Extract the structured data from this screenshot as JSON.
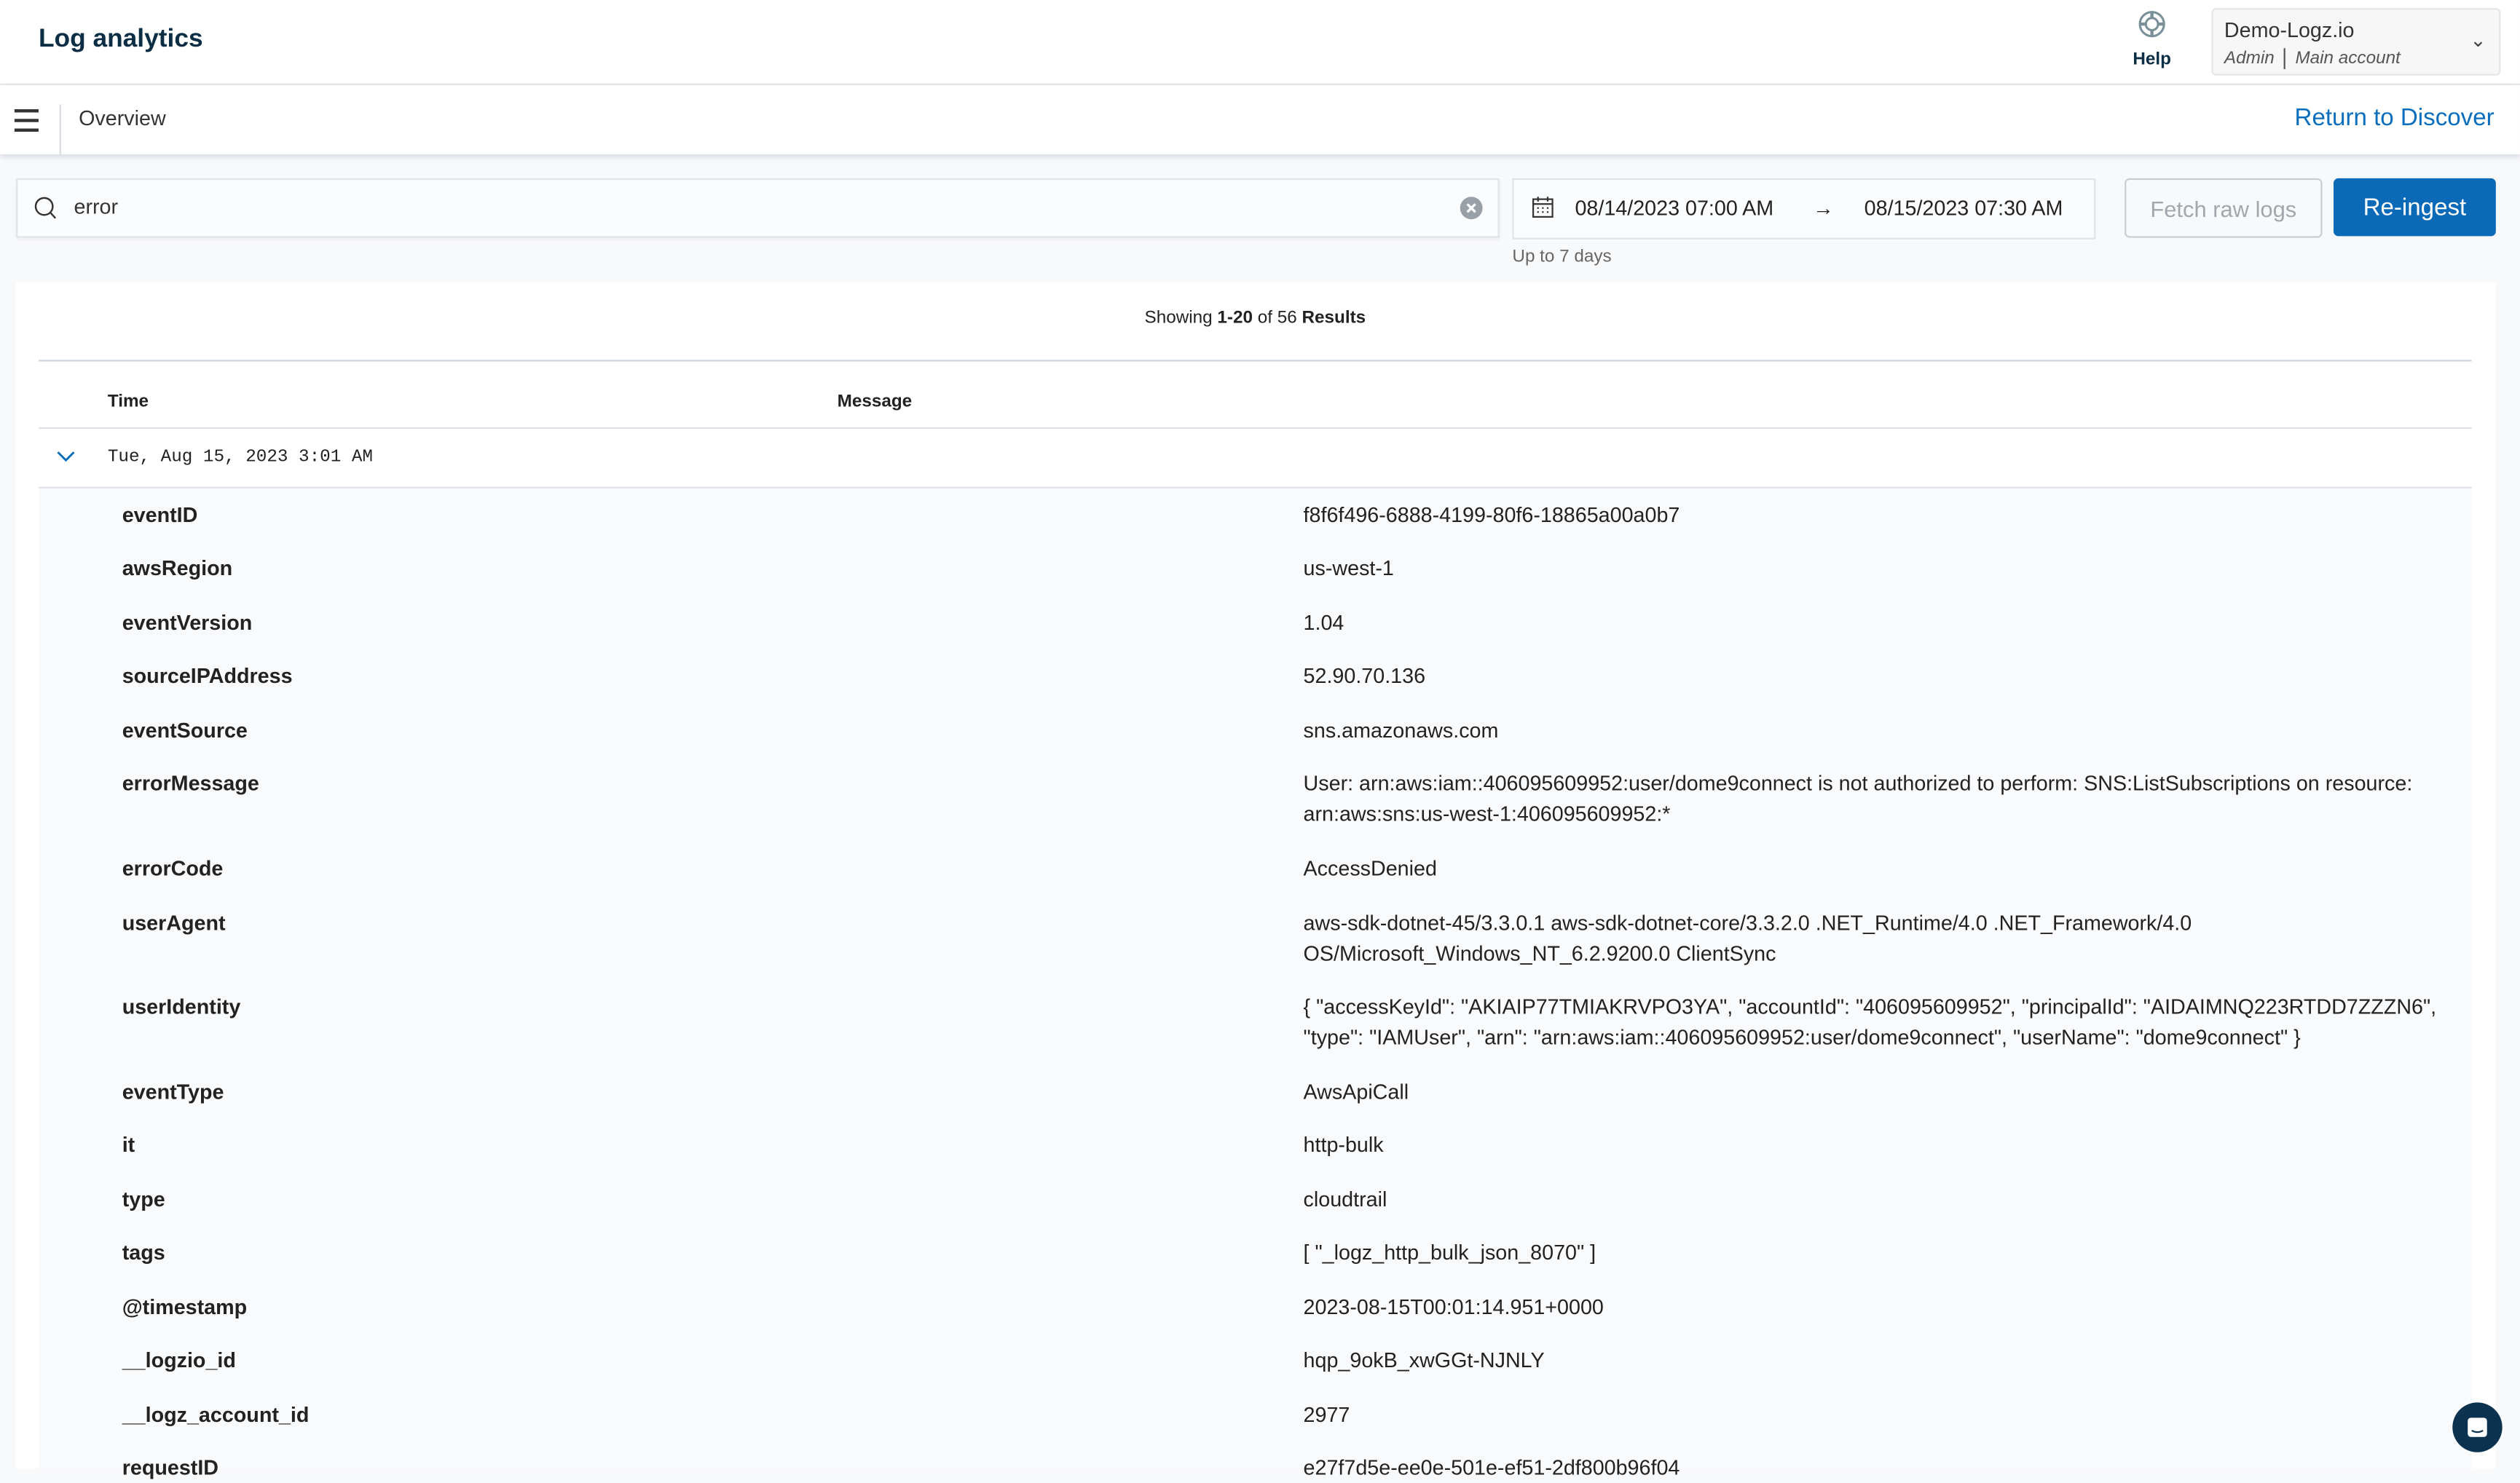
{
  "header": {
    "title": "Log analytics",
    "help_label": "Help",
    "account": {
      "name": "Demo-Logz.io",
      "role": "Admin",
      "type": "Main account"
    }
  },
  "nav": {
    "page": "Overview",
    "return_link": "Return to Discover"
  },
  "search": {
    "value": "error"
  },
  "date_range": {
    "from": "08/14/2023 07:00 AM",
    "to": "08/15/2023 07:30 AM",
    "hint": "Up to 7 days"
  },
  "buttons": {
    "fetch": "Fetch raw logs",
    "reingest": "Re-ingest"
  },
  "results": {
    "prefix": "Showing ",
    "range": "1-20",
    "of": " of 56 ",
    "suffix": "Results"
  },
  "table": {
    "columns": [
      "Time",
      "Message"
    ],
    "row_time": "Tue, Aug 15, 2023 3:01 AM"
  },
  "fields": [
    {
      "key": "eventID",
      "value": "f8f6f496-6888-4199-80f6-18865a00a0b7"
    },
    {
      "key": "awsRegion",
      "value": "us-west-1"
    },
    {
      "key": "eventVersion",
      "value": "1.04"
    },
    {
      "key": "sourceIPAddress",
      "value": "52.90.70.136"
    },
    {
      "key": "eventSource",
      "value": "sns.amazonaws.com"
    },
    {
      "key": "errorMessage",
      "value": "User: arn:aws:iam::406095609952:user/dome9connect is not authorized to perform: SNS:ListSubscriptions on resource: arn:aws:sns:us-west-1:406095609952:*"
    },
    {
      "key": "errorCode",
      "value": "AccessDenied"
    },
    {
      "key": "userAgent",
      "value": "aws-sdk-dotnet-45/3.3.0.1 aws-sdk-dotnet-core/3.3.2.0 .NET_Runtime/4.0 .NET_Framework/4.0 OS/Microsoft_Windows_NT_6.2.9200.0 ClientSync"
    },
    {
      "key": "userIdentity",
      "value": "{ \"accessKeyId\": \"AKIAIP77TMIAKRVPO3YA\", \"accountId\": \"406095609952\", \"principalId\": \"AIDAIMNQ223RTDD7ZZZN6\", \"type\": \"IAMUser\", \"arn\": \"arn:aws:iam::406095609952:user/dome9connect\", \"userName\": \"dome9connect\" }"
    },
    {
      "key": "eventType",
      "value": "AwsApiCall"
    },
    {
      "key": "it",
      "value": "http-bulk"
    },
    {
      "key": "type",
      "value": "cloudtrail"
    },
    {
      "key": "tags",
      "value": "[ \"_logz_http_bulk_json_8070\" ]"
    },
    {
      "key": "@timestamp",
      "value": "2023-08-15T00:01:14.951+0000"
    },
    {
      "key": "__logzio_id",
      "value": "hqp_9okB_xwGGt-NJNLY"
    },
    {
      "key": "__logz_account_id",
      "value": "2977"
    },
    {
      "key": "requestID",
      "value": "e27f7d5e-ee0e-501e-ef51-2df800b96f04"
    }
  ],
  "colors": {
    "accent": "#0a6ab8",
    "link": "#0a6ebd",
    "title": "#0b2e45"
  }
}
